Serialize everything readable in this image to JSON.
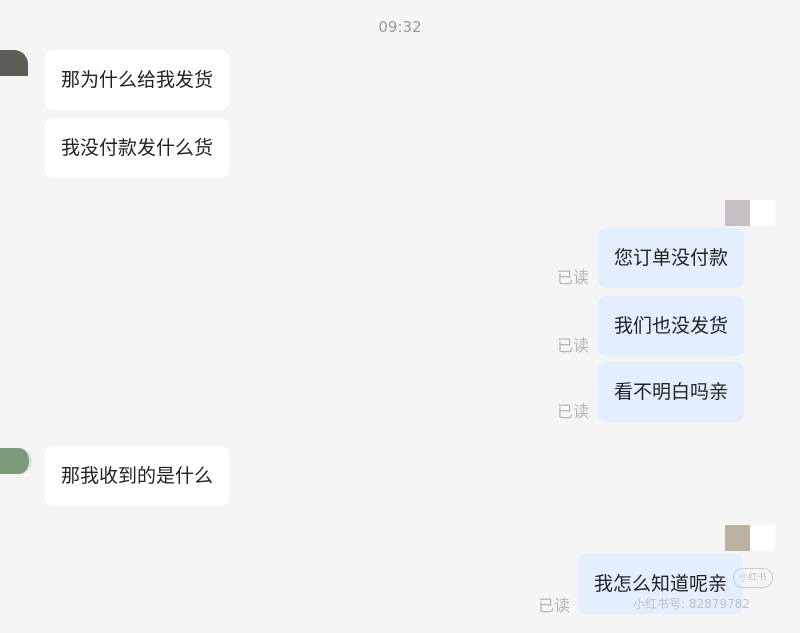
{
  "timestamp": "09:32",
  "read_label": "已读",
  "messages": [
    {
      "side": "incoming",
      "text": "那为什么给我发货"
    },
    {
      "side": "incoming",
      "text": "我没付款发什么货"
    },
    {
      "side": "outgoing",
      "text": "您订单没付款",
      "status": "已读"
    },
    {
      "side": "outgoing",
      "text": "我们也没发货",
      "status": "已读"
    },
    {
      "side": "outgoing",
      "text": "看不明白吗亲",
      "status": "已读"
    },
    {
      "side": "incoming",
      "text": "那我收到的是什么"
    },
    {
      "side": "outgoing",
      "text": "我怎么知道呢亲",
      "status": "已读"
    }
  ],
  "watermark": {
    "logo_text": "小红书",
    "id_text": "小红书号: 82879782"
  },
  "colors": {
    "background": "#f5f5f5",
    "incoming_bubble": "#ffffff",
    "outgoing_bubble": "#e3efff",
    "read_status": "#b5b5b5",
    "timestamp": "#9a9a9a"
  },
  "icons": {
    "contact_avatar": "avatar",
    "own_avatar": "avatar"
  }
}
